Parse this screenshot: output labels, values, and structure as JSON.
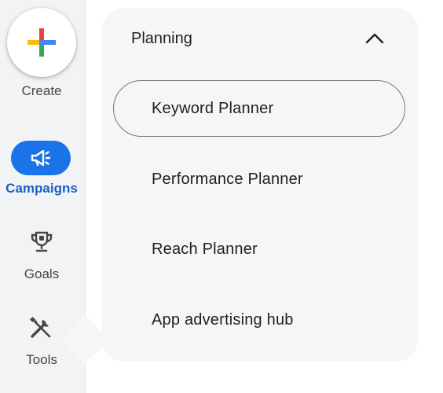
{
  "rail": {
    "create_label": "Create",
    "items": [
      {
        "label": "Campaigns",
        "icon": "megaphone-icon",
        "active": true
      },
      {
        "label": "Goals",
        "icon": "trophy-icon",
        "active": false
      },
      {
        "label": "Tools",
        "icon": "tools-icon",
        "active": false
      }
    ]
  },
  "panel": {
    "section_title": "Planning",
    "section_icon": "chevron-up-icon",
    "items": [
      {
        "label": "Keyword Planner",
        "selected": true
      },
      {
        "label": "Performance Planner",
        "selected": false
      },
      {
        "label": "Reach Planner",
        "selected": false
      },
      {
        "label": "App advertising hub",
        "selected": false
      }
    ]
  },
  "colors": {
    "accent": "#1a73e8",
    "active_text": "#1a5fc8",
    "rail_bg": "#f1f3f4",
    "panel_bg": "#f5f6f8",
    "plus_blue": "#4285f4",
    "plus_red": "#ea4335",
    "plus_yellow": "#fbbc04",
    "plus_green": "#34a853"
  }
}
